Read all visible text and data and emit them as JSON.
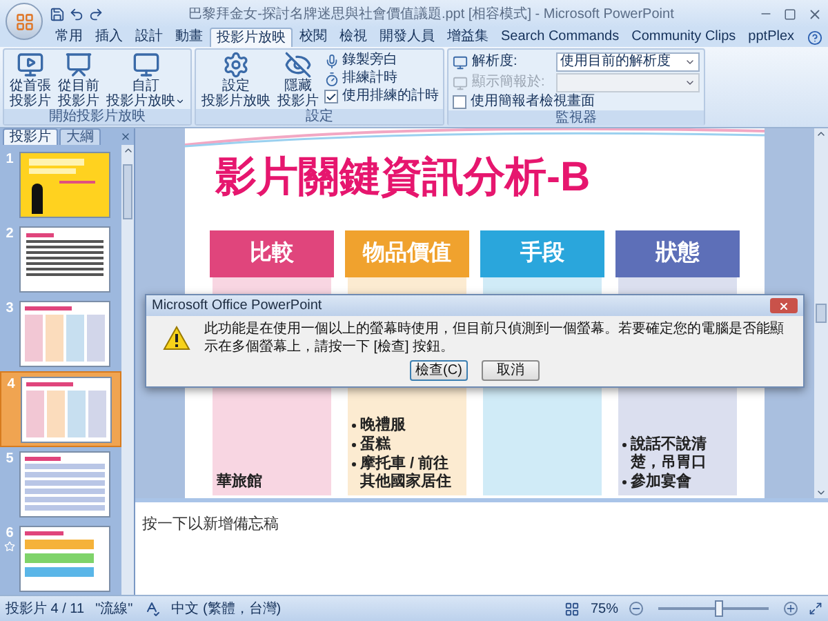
{
  "window": {
    "title": "巴黎拜金女-探討名牌迷思與社會價值議題.ppt [相容模式] - Microsoft PowerPoint"
  },
  "ribbon_tabs": [
    {
      "label": "常用",
      "selected": false
    },
    {
      "label": "插入",
      "selected": false
    },
    {
      "label": "設計",
      "selected": false
    },
    {
      "label": "動畫",
      "selected": false
    },
    {
      "label": "投影片放映",
      "selected": true
    },
    {
      "label": "校閱",
      "selected": false
    },
    {
      "label": "檢視",
      "selected": false
    },
    {
      "label": "開發人員",
      "selected": false
    },
    {
      "label": "增益集",
      "selected": false
    },
    {
      "label": "Search Commands",
      "selected": false
    },
    {
      "label": "Community Clips",
      "selected": false
    },
    {
      "label": "pptPlex",
      "selected": false
    }
  ],
  "ribbon_groups": [
    {
      "label": "開始投影片放映",
      "large": [
        {
          "kind": "play_first",
          "lines": [
            "從首張",
            "投影片"
          ]
        },
        {
          "kind": "play_current",
          "lines": [
            "從目前",
            "投影片"
          ]
        },
        {
          "kind": "custom",
          "lines": [
            "自訂",
            "投影片放映"
          ],
          "dropdown": true
        }
      ]
    },
    {
      "label": "設定",
      "large": [
        {
          "kind": "setup",
          "lines": [
            "設定",
            "投影片放映"
          ]
        },
        {
          "kind": "hide",
          "lines": [
            "隱藏",
            "投影片"
          ]
        }
      ],
      "small": [
        {
          "kind": "record",
          "label": "錄製旁白"
        },
        {
          "kind": "rehearse",
          "label": "排練計時"
        },
        {
          "kind": "check",
          "label": "使用排練的計時",
          "checked": true,
          "disabled": false
        }
      ]
    },
    {
      "label": "監視器",
      "small": [
        {
          "kind": "select",
          "label": "解析度:",
          "value": "使用目前的解析度",
          "disabled": false
        },
        {
          "kind": "select",
          "label": "顯示簡報於:",
          "disabled": true
        },
        {
          "kind": "check",
          "label": "使用簡報者檢視畫面",
          "checked": false,
          "disabled": false
        }
      ]
    }
  ],
  "slide_panel": {
    "tabs": [
      {
        "label": "投影片",
        "selected": true
      },
      {
        "label": "大綱",
        "selected": false
      }
    ],
    "slides": [
      {
        "number": "1",
        "kind": "title",
        "selected": false,
        "starred": false
      },
      {
        "number": "2",
        "kind": "text",
        "selected": false,
        "starred": false
      },
      {
        "number": "3",
        "kind": "columns",
        "selected": false,
        "starred": false
      },
      {
        "number": "4",
        "kind": "columns",
        "selected": true,
        "starred": false
      },
      {
        "number": "5",
        "kind": "list",
        "selected": false,
        "starred": false
      },
      {
        "number": "6",
        "kind": "arrows",
        "selected": false,
        "starred": true
      }
    ]
  },
  "slide": {
    "title": "影片關鍵資訊分析-B",
    "columns": [
      {
        "header": "比較",
        "color": "#e0457c",
        "items": [
          {
            "text": "華旅館",
            "bullet": false
          }
        ]
      },
      {
        "header": "物品價值",
        "color": "#f0a22e",
        "items": [
          {
            "text": "晚禮服",
            "bullet": true
          },
          {
            "text": "蛋糕",
            "bullet": true
          },
          {
            "text": "摩托車 / 前往其他國家居住",
            "bullet": true
          }
        ]
      },
      {
        "header": "手段",
        "color": "#2aa6dc"
      },
      {
        "header": "狀態",
        "color": "#5d6fb8",
        "items": [
          {
            "text": "說話不說清楚，吊胃口",
            "bullet": true
          },
          {
            "text": "參加宴會",
            "bullet": true
          }
        ]
      }
    ]
  },
  "notes": {
    "placeholder": "按一下以新增備忘稿"
  },
  "dialog": {
    "title": "Microsoft Office PowerPoint",
    "message": "此功能是在使用一個以上的螢幕時使用，但目前只偵測到一個螢幕。若要確定您的電腦是否能顯示在多個螢幕上，請按一下 [檢查] 按鈕。",
    "buttons": [
      {
        "label": "檢查(C)",
        "selected": true
      },
      {
        "label": "取消",
        "selected": false
      }
    ]
  },
  "status_bar": {
    "slide": "投影片 4 / 11",
    "theme": "\"流線\"",
    "language": "中文 (繁體，台灣)",
    "zoom": "75%",
    "zoom_slider": {
      "level": 0.55
    }
  }
}
